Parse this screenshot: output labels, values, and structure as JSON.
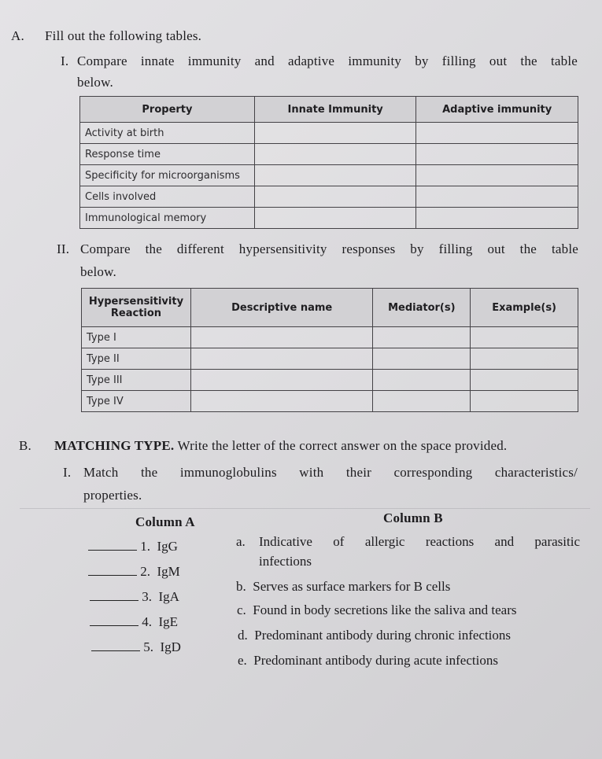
{
  "sectionA": {
    "letter": "A.",
    "title": "Fill out the following tables.",
    "part1": {
      "numeral": "I.",
      "instruction_line1": "Compare innate immunity and adaptive immunity by filling out the table",
      "instruction_line2": "below.",
      "table": {
        "headers": [
          "Property",
          "Innate Immunity",
          "Adaptive immunity"
        ],
        "rows": [
          [
            "Activity at birth",
            "",
            ""
          ],
          [
            "Response time",
            "",
            ""
          ],
          [
            "Specificity for microorganisms",
            "",
            ""
          ],
          [
            "Cells involved",
            "",
            ""
          ],
          [
            "Immunological memory",
            "",
            ""
          ]
        ]
      }
    },
    "part2": {
      "numeral": "II.",
      "instruction_line1": "Compare the different hypersensitivity responses by filling out the table",
      "instruction_line2": "below.",
      "table": {
        "headers": [
          "Hypersensitivity Reaction",
          "Descriptive name",
          "Mediator(s)",
          "Example(s)"
        ],
        "header0_line1": "Hypersensitivity",
        "header0_line2": "Reaction",
        "rows": [
          [
            "Type I",
            "",
            "",
            ""
          ],
          [
            "Type II",
            "",
            "",
            ""
          ],
          [
            "Type III",
            "",
            "",
            ""
          ],
          [
            "Type IV",
            "",
            "",
            ""
          ]
        ]
      }
    }
  },
  "sectionB": {
    "letter": "B.",
    "title_bold": "MATCHING TYPE.",
    "title_rest": "Write the letter of the correct answer on the space provided.",
    "part1": {
      "numeral": "I.",
      "instruction_line1": "Match the immunoglobulins with their corresponding characteristics/",
      "instruction_line2": "properties.",
      "columnA_label": "Column A",
      "columnB_label": "Column B",
      "columnA": [
        {
          "num": "1.",
          "item": "IgG",
          "answer": ""
        },
        {
          "num": "2.",
          "item": "IgM",
          "answer": ""
        },
        {
          "num": "3.",
          "item": "IgA",
          "answer": ""
        },
        {
          "num": "4.",
          "item": "IgE",
          "answer": ""
        },
        {
          "num": "5.",
          "item": "IgD",
          "answer": ""
        }
      ],
      "columnB": [
        {
          "letter": "a.",
          "text_line1": "Indicative of allergic reactions and parasitic",
          "text_line2": "infections"
        },
        {
          "letter": "b.",
          "text_line1": "Serves as surface markers for B cells"
        },
        {
          "letter": "c.",
          "text_line1": "Found in body secretions like the saliva and tears"
        },
        {
          "letter": "d.",
          "text_line1": "Predominant antibody during chronic infections"
        },
        {
          "letter": "e.",
          "text_line1": "Predominant antibody during acute infections"
        }
      ]
    }
  }
}
